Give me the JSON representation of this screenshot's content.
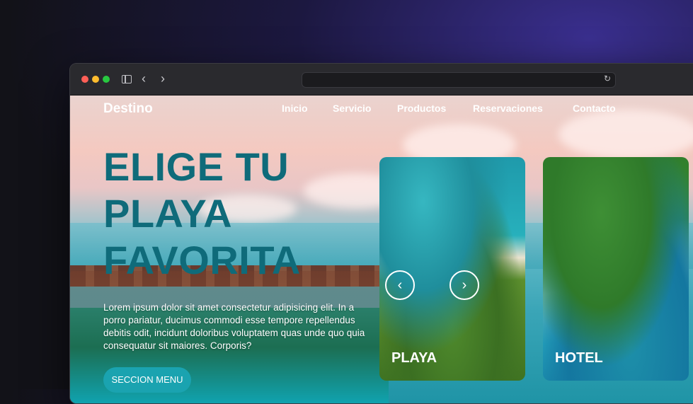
{
  "browser": {
    "url": "",
    "back_icon": "chevron-left-icon",
    "forward_icon": "chevron-right-icon",
    "reload_icon": "reload-icon"
  },
  "site": {
    "brand": "Destino",
    "nav": [
      {
        "label": "Inicio"
      },
      {
        "label": "Servicio"
      },
      {
        "label": "Productos"
      },
      {
        "label": "Reservaciones"
      },
      {
        "label": "Contacto"
      }
    ]
  },
  "hero": {
    "title_line1": "ELIGE TU",
    "title_line2": "PLAYA",
    "title_line3": "FAVORITA",
    "text": "Lorem ipsum dolor sit amet consectetur adipisicing elit. In a porro pariatur, ducimus commodi esse tempore repellendus debitis odit, incidunt doloribus voluptatem quas unde quo quia consequatur sit maiores. Corporis?",
    "cta": "SECCION MENU",
    "title_color": "#0f6b7a",
    "accent": "#1aa3b0"
  },
  "cards": [
    {
      "label": "PLAYA"
    },
    {
      "label": "HOTEL"
    }
  ],
  "slider": {
    "prev_icon": "chevron-left-icon",
    "next_icon": "chevron-right-icon"
  }
}
